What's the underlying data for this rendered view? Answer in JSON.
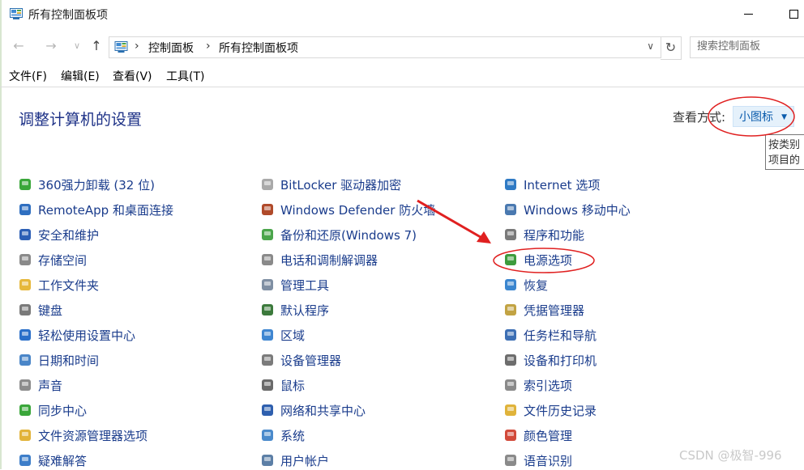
{
  "window": {
    "title": "所有控制面板项"
  },
  "navigation": {
    "breadcrumbs": [
      "控制面板",
      "所有控制面板项"
    ],
    "search_placeholder": "搜索控制面板"
  },
  "menu": [
    "文件(F)",
    "编辑(E)",
    "查看(V)",
    "工具(T)"
  ],
  "header": {
    "title": "调整计算机的设置",
    "view_label": "查看方式:",
    "view_value": "小图标",
    "tooltip_lines": [
      "按类别",
      "项目的"
    ]
  },
  "columns": [
    {
      "items": [
        {
          "label": "360强力卸载 (32 位)",
          "icon": "uninstall-icon",
          "color": "#3aa73a"
        },
        {
          "label": "RemoteApp 和桌面连接",
          "icon": "remote-desktop-icon",
          "color": "#2f6fc0"
        },
        {
          "label": "安全和维护",
          "icon": "flag-icon",
          "color": "#2d5fb5"
        },
        {
          "label": "存储空间",
          "icon": "storage-icon",
          "color": "#8a8a8a"
        },
        {
          "label": "工作文件夹",
          "icon": "folder-icon",
          "color": "#e6b83c"
        },
        {
          "label": "键盘",
          "icon": "keyboard-icon",
          "color": "#7a7a7a"
        },
        {
          "label": "轻松使用设置中心",
          "icon": "ease-of-access-icon",
          "color": "#2a6fc9"
        },
        {
          "label": "日期和时间",
          "icon": "clock-icon",
          "color": "#4a86c8"
        },
        {
          "label": "声音",
          "icon": "speaker-icon",
          "color": "#8c8c8c"
        },
        {
          "label": "同步中心",
          "icon": "sync-icon",
          "color": "#3aa63a"
        },
        {
          "label": "文件资源管理器选项",
          "icon": "folder-options-icon",
          "color": "#e2b33a"
        },
        {
          "label": "疑难解答",
          "icon": "troubleshoot-icon",
          "color": "#3d7ec9"
        }
      ]
    },
    {
      "items": [
        {
          "label": "BitLocker 驱动器加密",
          "icon": "key-icon",
          "color": "#a9a9a9"
        },
        {
          "label": "Windows Defender 防火墙",
          "icon": "firewall-icon",
          "color": "#b04a2a"
        },
        {
          "label": "备份和还原(Windows 7)",
          "icon": "backup-icon",
          "color": "#4ba54b"
        },
        {
          "label": "电话和调制解调器",
          "icon": "phone-icon",
          "color": "#8a8a8a"
        },
        {
          "label": "管理工具",
          "icon": "admin-tools-icon",
          "color": "#7f8fa3"
        },
        {
          "label": "默认程序",
          "icon": "default-programs-icon",
          "color": "#3c7a3c"
        },
        {
          "label": "区域",
          "icon": "globe-icon",
          "color": "#3f86d1"
        },
        {
          "label": "设备管理器",
          "icon": "device-manager-icon",
          "color": "#7b7b7b"
        },
        {
          "label": "鼠标",
          "icon": "mouse-icon",
          "color": "#6a6a6a"
        },
        {
          "label": "网络和共享中心",
          "icon": "network-icon",
          "color": "#2e5fae"
        },
        {
          "label": "系统",
          "icon": "system-icon",
          "color": "#4a8acb"
        },
        {
          "label": "用户帐户",
          "icon": "user-accounts-icon",
          "color": "#5c7fa6"
        }
      ]
    },
    {
      "items": [
        {
          "label": "Internet 选项",
          "icon": "internet-icon",
          "color": "#2f7ac4"
        },
        {
          "label": "Windows 移动中心",
          "icon": "mobility-icon",
          "color": "#4a79b0"
        },
        {
          "label": "程序和功能",
          "icon": "programs-icon",
          "color": "#7a7a7a"
        },
        {
          "label": "电源选项",
          "icon": "power-icon",
          "color": "#3d9c3d"
        },
        {
          "label": "恢复",
          "icon": "recovery-icon",
          "color": "#3b86cf"
        },
        {
          "label": "凭据管理器",
          "icon": "credential-icon",
          "color": "#c2a343"
        },
        {
          "label": "任务栏和导航",
          "icon": "taskbar-icon",
          "color": "#3d6fb4"
        },
        {
          "label": "设备和打印机",
          "icon": "printer-icon",
          "color": "#6d6d6d"
        },
        {
          "label": "索引选项",
          "icon": "index-icon",
          "color": "#8a8a8a"
        },
        {
          "label": "文件历史记录",
          "icon": "file-history-icon",
          "color": "#e0b33a"
        },
        {
          "label": "颜色管理",
          "icon": "color-management-icon",
          "color": "#d24a3a"
        },
        {
          "label": "语音识别",
          "icon": "microphone-icon",
          "color": "#8a8a8a"
        }
      ]
    }
  ],
  "watermark": "CSDN @极智-996",
  "colors": {
    "link": "#1a3c8c",
    "title": "#1e3287",
    "annotation": "#e02020"
  }
}
